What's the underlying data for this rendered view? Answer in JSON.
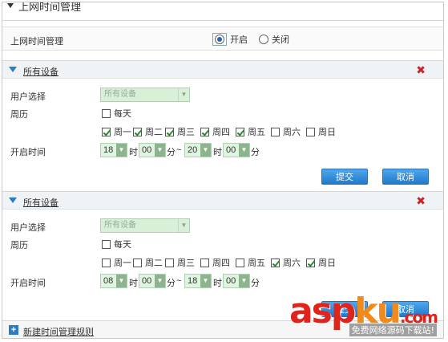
{
  "top": {
    "title": "上网时间管理"
  },
  "mgmt": {
    "label": "上网时间管理",
    "on_label": "开启",
    "off_label": "关闭",
    "selected": "开启"
  },
  "rules": [
    {
      "title": "所有设备",
      "user_select_label": "用户选择",
      "user_select_value": "所有设备",
      "calendar_label": "周历",
      "everyday_label": "每天",
      "days": [
        {
          "label": "周一",
          "checked": true
        },
        {
          "label": "周二",
          "checked": true
        },
        {
          "label": "周三",
          "checked": true
        },
        {
          "label": "周四",
          "checked": true
        },
        {
          "label": "周五",
          "checked": true
        },
        {
          "label": "周六",
          "checked": false
        },
        {
          "label": "周日",
          "checked": false
        }
      ],
      "open_time_label": "开启时间",
      "start_hour": "18",
      "start_min": "00",
      "end_hour": "20",
      "end_min": "00",
      "hour_unit": "时",
      "min_unit": "分",
      "tilde": "~",
      "submit_label": "提交",
      "cancel_label": "取消"
    },
    {
      "title": "所有设备",
      "user_select_label": "用户选择",
      "user_select_value": "所有设备",
      "calendar_label": "周历",
      "everyday_label": "每天",
      "days": [
        {
          "label": "周一",
          "checked": false
        },
        {
          "label": "周二",
          "checked": false
        },
        {
          "label": "周三",
          "checked": false
        },
        {
          "label": "周四",
          "checked": false
        },
        {
          "label": "周五",
          "checked": false
        },
        {
          "label": "周六",
          "checked": true
        },
        {
          "label": "周日",
          "checked": true
        }
      ],
      "open_time_label": "开启时间",
      "start_hour": "08",
      "start_min": "00",
      "end_hour": "18",
      "end_min": "00",
      "hour_unit": "时",
      "min_unit": "分",
      "tilde": "~",
      "submit_label": "提交",
      "cancel_label": "取消"
    }
  ],
  "footer": {
    "new_rule_label": "新建时间管理规则"
  },
  "watermark": {
    "text_a": "asp",
    "text_b": "ku",
    "text_c": ".com",
    "subtext": "免费网络源码下载站!"
  },
  "colors": {
    "accent": "#2a7cc4",
    "delete": "#c8252b",
    "button": "#2279c9"
  }
}
